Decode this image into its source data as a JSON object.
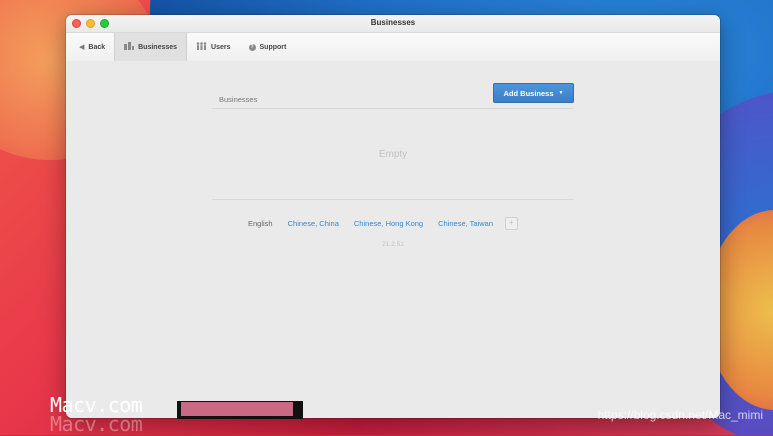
{
  "window": {
    "title": "Businesses"
  },
  "toolbar": {
    "back_label": "Back",
    "businesses_label": "Businesses",
    "users_label": "Users",
    "support_label": "Support"
  },
  "main": {
    "section_label": "Businesses",
    "add_button_label": "Add Business",
    "empty_text": "Empty",
    "languages": [
      "English",
      "Chinese, China",
      "Chinese, Hong Kong",
      "Chinese, Taiwan"
    ],
    "plus_label": "+",
    "version": "21.2.51"
  },
  "overlay": {
    "watermark": "Macv.com",
    "watermark_shadow": "Macv.com",
    "credit": "https://blog.csdn.net/Mac_mimi"
  },
  "colors": {
    "accent": "#3a7fc8",
    "link": "#3a86c8"
  }
}
